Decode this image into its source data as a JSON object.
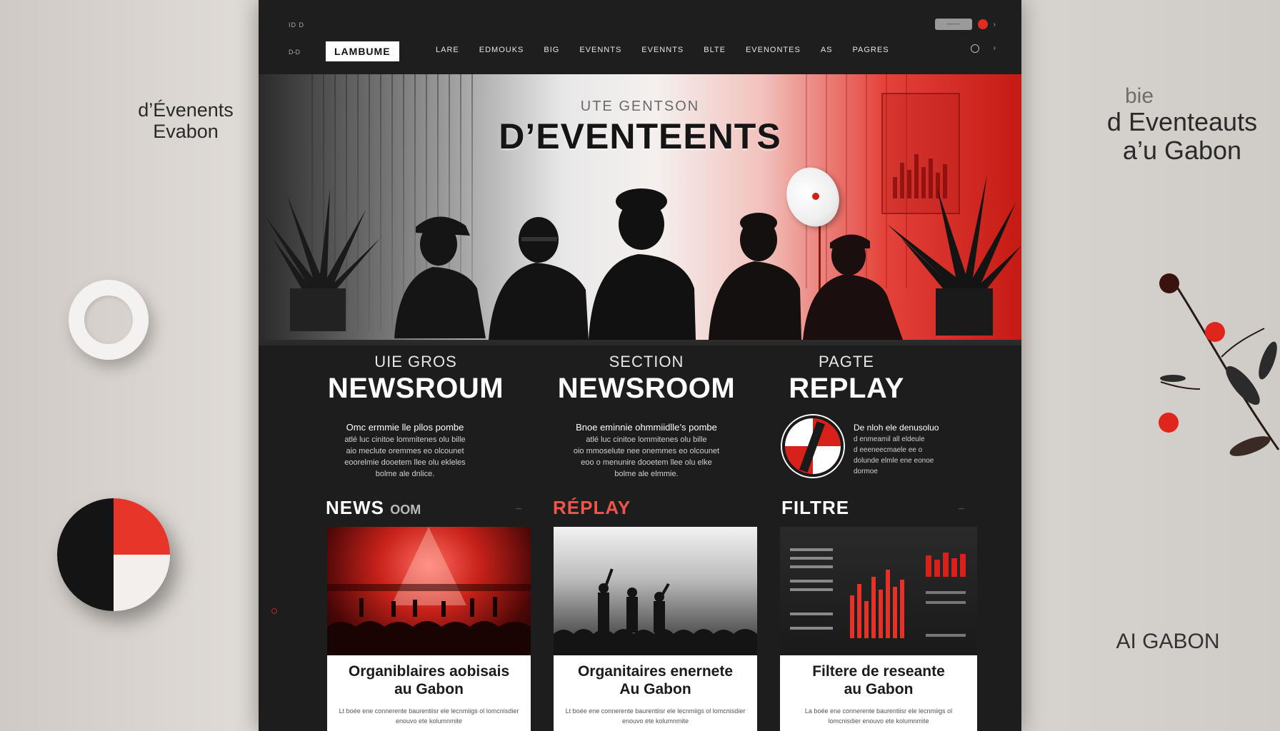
{
  "side": {
    "left_title_line1": "d’Évenents",
    "left_title_line2": "Evabon",
    "right_title_top": "bie",
    "right_title_line1": "d Eventeauts",
    "right_title_line2": "a’u Gabon",
    "right_bottom": "AI GABON"
  },
  "topbar": {
    "small_left": "ID D",
    "small_left2": "D-D",
    "util_pill": "-------",
    "util_chevron": "›"
  },
  "nav": {
    "logo": "LAMBUME",
    "items": [
      "LARE",
      "EDMOUKS",
      "BIG",
      "EVENNTS",
      "EVENNTS",
      "BLTE",
      "EVENONTES",
      "AS",
      "PAGRES"
    ],
    "icon_chevron": "›"
  },
  "hero": {
    "subtitle": "UTE GENTSON",
    "title": "D’EVENTEENTS"
  },
  "columns": [
    {
      "kicker": "UIE GROS",
      "big": "NEWSROUM",
      "text_line1": "Omc ermmie lle pllos pombe",
      "text_lines": [
        "atlé luc cinitoe lommitenes olu bille",
        "aio meclute oremmes eo olcounet",
        "eoorelmie dooetem llee olu ekleles",
        "bolme ale dnlice."
      ]
    },
    {
      "kicker": "SECTION",
      "big": "NEWSROOM",
      "text_line1": "Bnoe eminnie ohmmiidlle’s pombe",
      "text_lines": [
        "atlé luc cinitoe lommitenes olu bille",
        "oio mmoselute nee onemmes eo olcounet",
        "eoo o menunire dooetem llee olu elke",
        "bolme ale elmmie."
      ]
    },
    {
      "kicker": "PAGTE",
      "big": "REPLAY",
      "text_line1": "De nloh ele denusoluo",
      "text_lines": [
        "d enmeamil all eldeule",
        "d eeeneecmaele ee o",
        "dolunde elmle ene eonoe",
        "dormoe"
      ]
    }
  ],
  "sections": {
    "news": "NEWS",
    "news_suffix": "OOM",
    "replay": "RÉPLAY",
    "filter": "FILTRE",
    "mini1": "―",
    "mini2": "―"
  },
  "cards": [
    {
      "title_line1": "Organiblaires aobisais",
      "title_line2": "au Gabon",
      "body": "Lt boée ene connerente baurentiisr ele lecnmiigs ol lomcnisdier enouvo ete kolumnmite"
    },
    {
      "title_line1": "Organitaires enernete",
      "title_line2": "Au Gabon",
      "body": "Lt boée ene connerente baurentiisr ele lecnmiigs ol lomcnisdier enouvo ete kolumnmite"
    },
    {
      "title_line1": "Filtere de reseante",
      "title_line2": "au Gabon",
      "body": "La boée ene connerente baurentiisr ele lecnmiigs ol lomcnisdier enouvo ete kolumnmite"
    }
  ],
  "colors": {
    "accent": "#e22b22",
    "background": "#1d1d1d",
    "text": "#ffffff"
  }
}
